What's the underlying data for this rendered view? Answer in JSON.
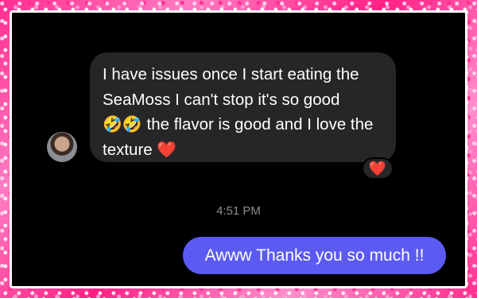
{
  "conversation": {
    "incoming": {
      "text_parts": [
        "I have issues once I start eating the SeaMoss I can't stop it's so good ",
        " the flavor is good and I love the texture "
      ],
      "emojis": {
        "laugh": "🤣🤣",
        "heart": "❤️"
      },
      "reaction": "❤️"
    },
    "timestamp": "4:51 PM",
    "outgoing": {
      "text": "Awww Thanks you so much !!"
    }
  },
  "colors": {
    "frame_glitter": "#ff4fa8",
    "screen_bg": "#000000",
    "incoming_bubble": "#262628",
    "outgoing_bubble": "#5b5af2",
    "timestamp": "#8e8e93",
    "heart": "#e10012"
  },
  "icons": {
    "avatar": "avatar-icon",
    "reaction": "heart-icon"
  }
}
